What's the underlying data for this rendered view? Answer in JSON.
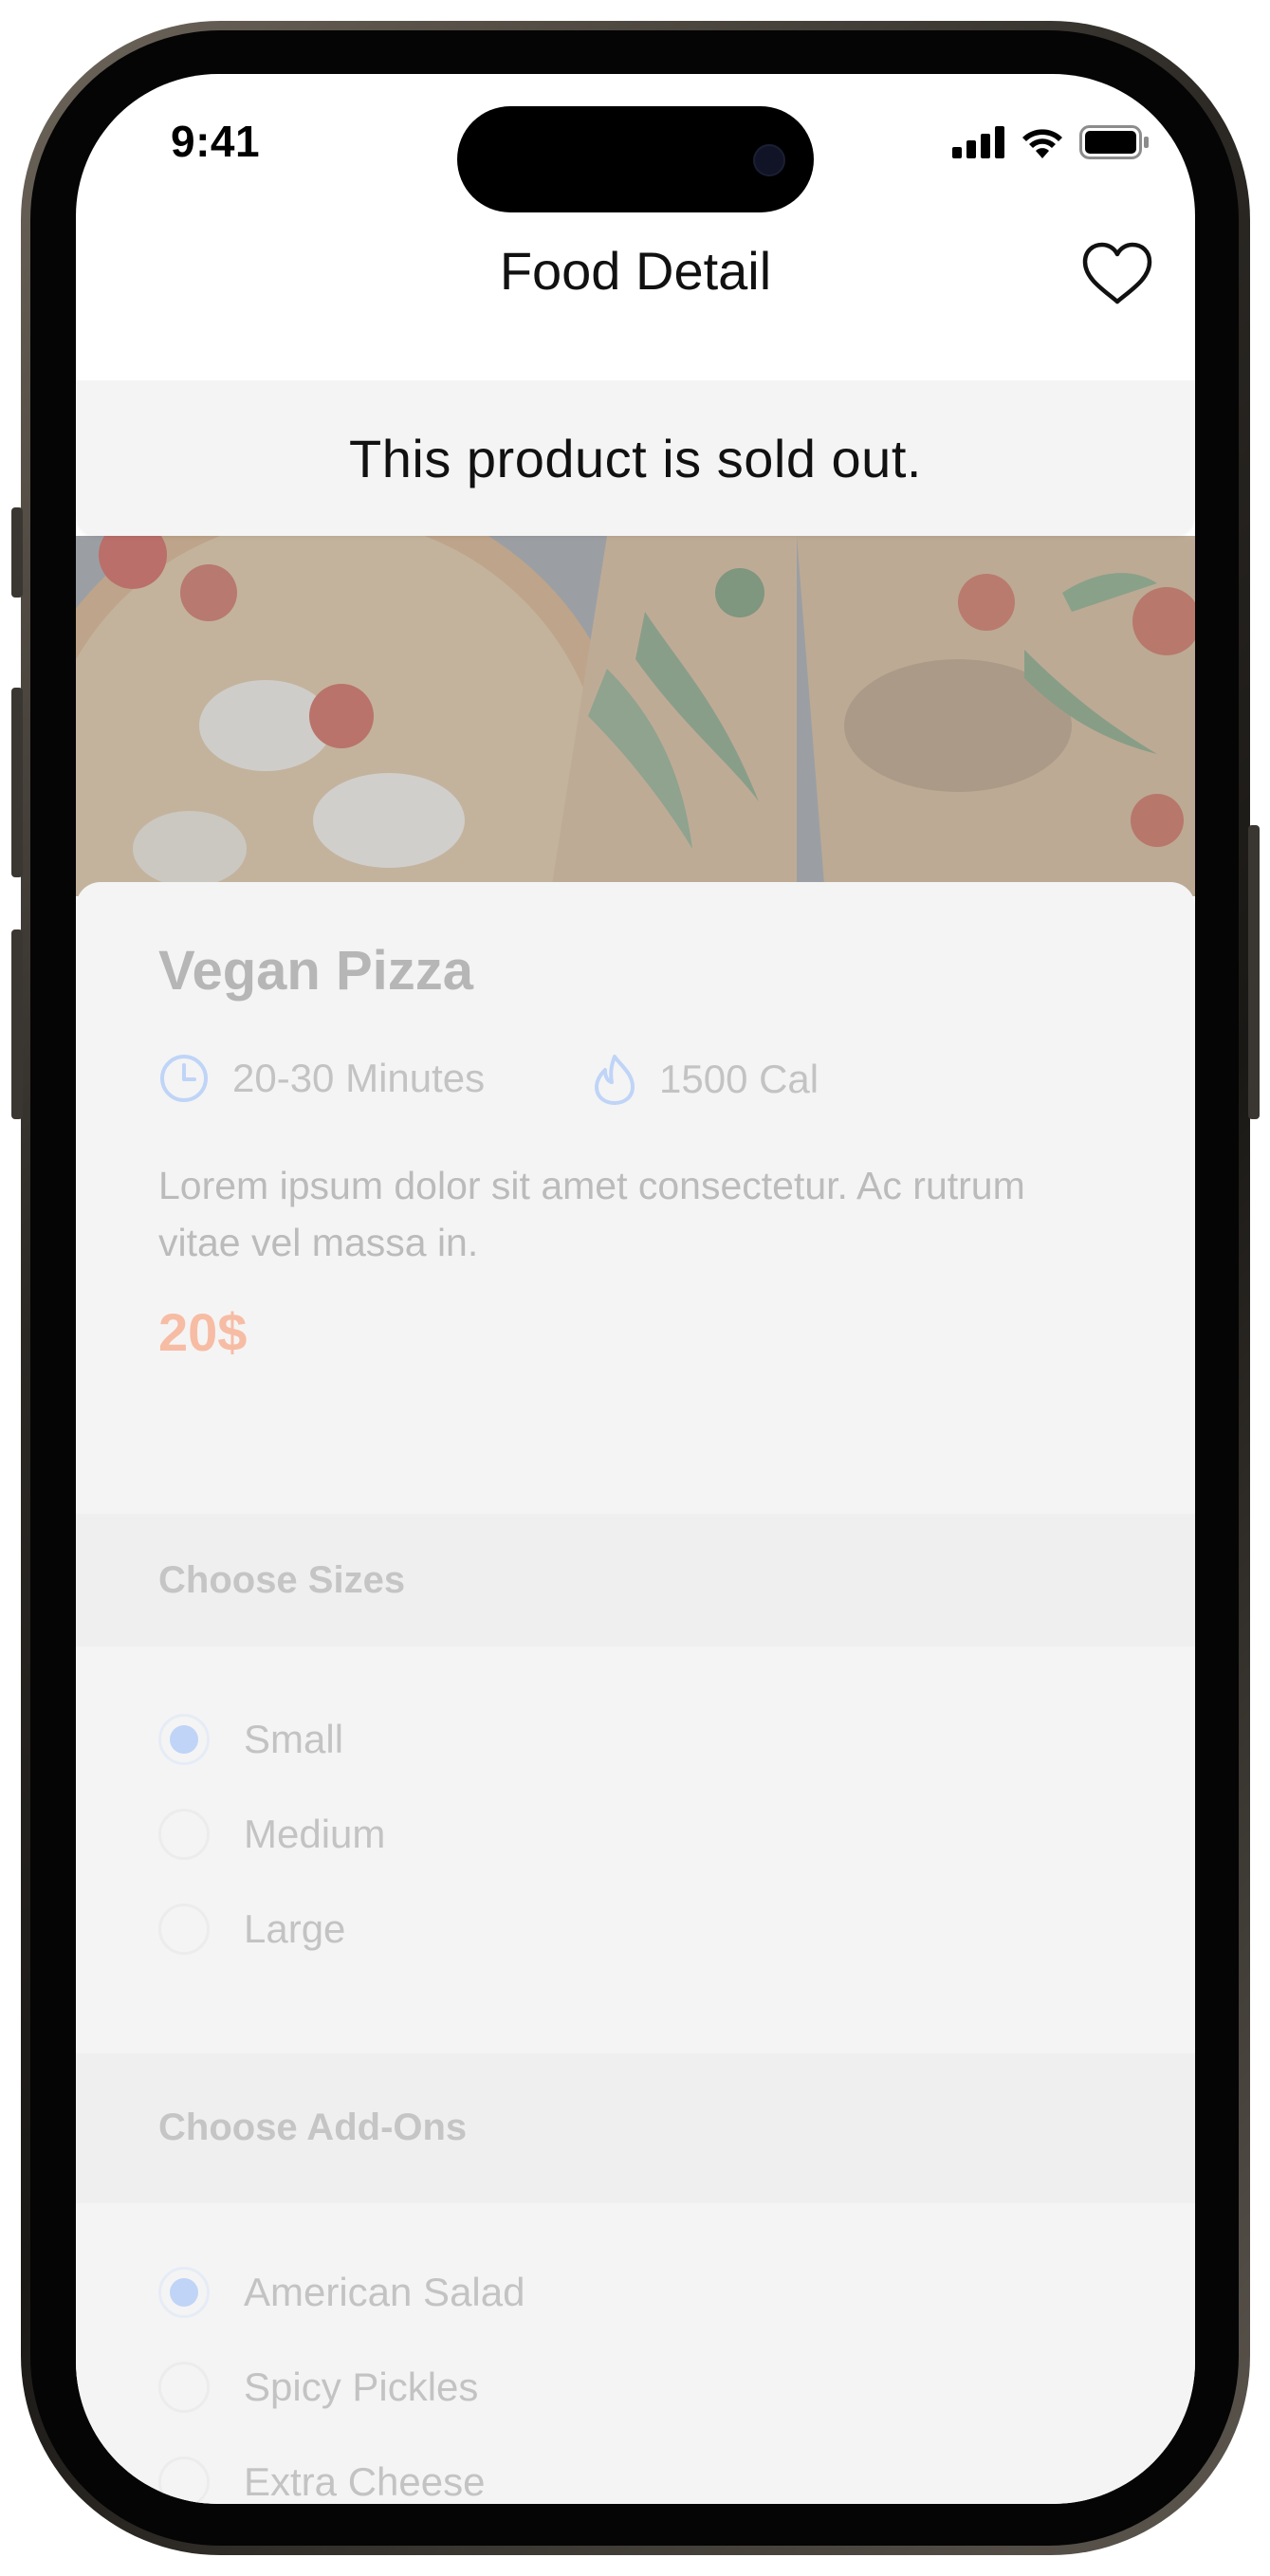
{
  "status_bar": {
    "time": "9:41"
  },
  "nav": {
    "title": "Food Detail",
    "favorite_icon": "heart-icon"
  },
  "banner": {
    "text": "This product is sold out."
  },
  "food": {
    "name": "Vegan Pizza",
    "time": "20-30 Minutes",
    "calories": "1500 Cal",
    "description": "Lorem ipsum dolor sit amet consectetur. Ac rutrum vitae vel massa in.",
    "price": "20$"
  },
  "sizes": {
    "title": "Choose Sizes",
    "options": [
      {
        "label": "Small",
        "selected": true
      },
      {
        "label": "Medium",
        "selected": false
      },
      {
        "label": "Large",
        "selected": false
      }
    ]
  },
  "addons": {
    "title": "Choose Add-Ons",
    "options": [
      {
        "label": "American Salad",
        "selected": true
      },
      {
        "label": "Spicy Pickles",
        "selected": false
      },
      {
        "label": "Extra Cheese",
        "selected": false
      }
    ]
  },
  "colors": {
    "accent_blue": "#bfd4f7",
    "price_orange": "#f7bca4",
    "disabled_text": "#c3c3c3"
  }
}
